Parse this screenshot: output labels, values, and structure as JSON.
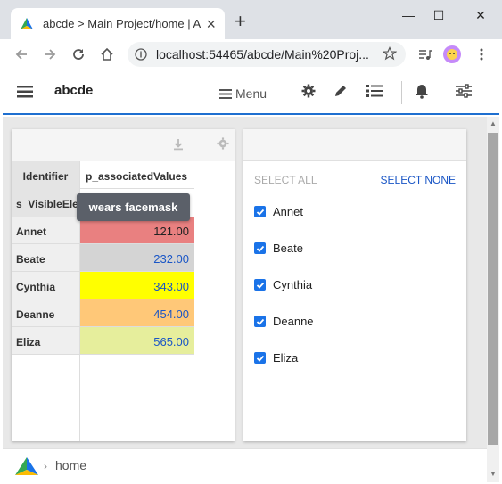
{
  "browser": {
    "tab_title": "abcde > Main Project/home | AIM",
    "tab_close": "×",
    "new_tab": "+",
    "minimize": "—",
    "maximize": "☐",
    "close": "✕",
    "url": "localhost:54465/abcde/Main%20Proj..."
  },
  "app": {
    "title": "abcde",
    "menu_label": "Menu"
  },
  "grid": {
    "header_identifier": "Identifier",
    "header_value": "p_associatedValues",
    "header2_identifier": "s_VisibleElements",
    "tooltip": "wears facemask",
    "rows": [
      {
        "id": "Annet",
        "value": "121.00",
        "color": "#e98080"
      },
      {
        "id": "Beate",
        "value": "232.00",
        "color": "#d4d4d4"
      },
      {
        "id": "Cynthia",
        "value": "343.00",
        "color": "#ffff00"
      },
      {
        "id": "Deanne",
        "value": "454.00",
        "color": "#ffc878"
      },
      {
        "id": "Eliza",
        "value": "565.00",
        "color": "#e6ee9c"
      }
    ]
  },
  "filter": {
    "select_all": "SELECT ALL",
    "select_none": "SELECT NONE",
    "items": [
      {
        "label": "Annet",
        "checked": true
      },
      {
        "label": "Beate",
        "checked": true
      },
      {
        "label": "Cynthia",
        "checked": true
      },
      {
        "label": "Deanne",
        "checked": true
      },
      {
        "label": "Eliza",
        "checked": true
      }
    ]
  },
  "footer": {
    "chevron": "›",
    "breadcrumb": "home"
  }
}
